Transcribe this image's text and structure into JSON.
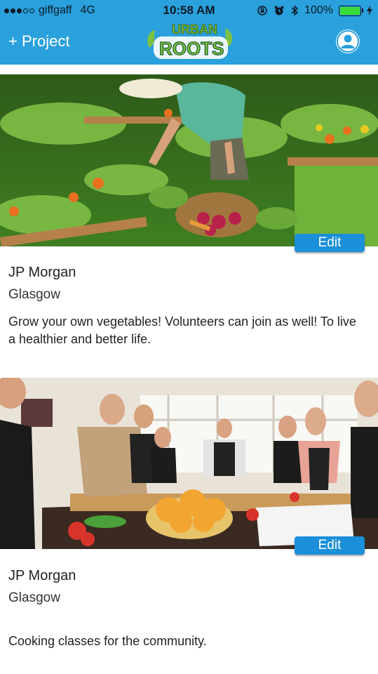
{
  "status": {
    "carrier": "giffgaff",
    "network": "4G",
    "time": "10:58 AM",
    "battery": "100%"
  },
  "header": {
    "add_project_label": "+ Project",
    "logo_text_top": "URBAN",
    "logo_text_bottom": "ROOTS",
    "colors": {
      "bar": "#2aa0dc",
      "button": "#1b8fd9"
    }
  },
  "projects": [
    {
      "organisation": "JP Morgan",
      "location": "Glasgow",
      "description": "Grow your own vegetables! Volunteers can join as well! To live a healthier and better life.",
      "edit_label": "Edit",
      "image": "vegetable-garden-photo"
    },
    {
      "organisation": "JP Morgan",
      "location": "Glasgow",
      "description": "Cooking classes for the community.",
      "edit_label": "Edit",
      "image": "cooking-class-photo"
    }
  ]
}
